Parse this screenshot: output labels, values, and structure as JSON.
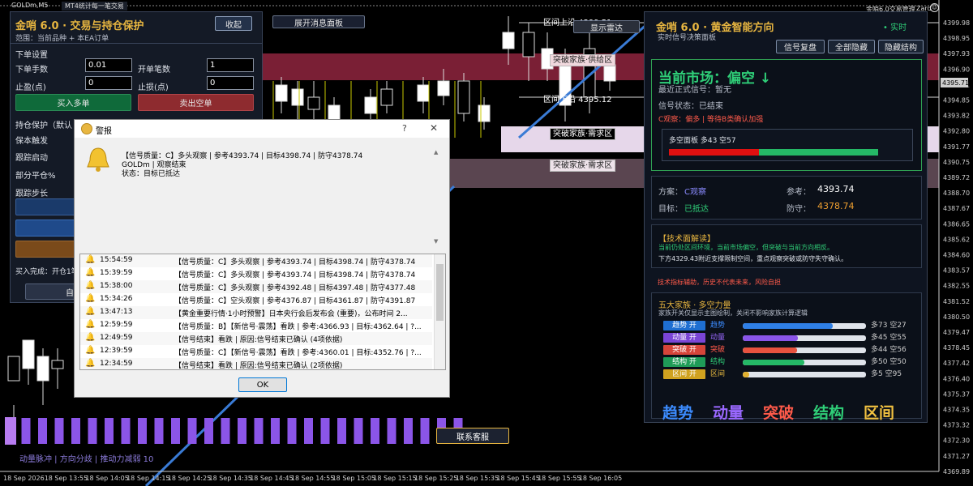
{
  "terminal": {
    "symbol_tab": "GOLDm,M5",
    "ea_tab": "MT4统计每一笔交易",
    "top_right_caption": "金哨6.0交易管理",
    "top_right_user": "Zard"
  },
  "colors": {
    "accent_gold": "#e8b640",
    "buy_green": "#0f6a3a",
    "sell_red": "#8e2b2f",
    "chart_line": "#3a7bd5",
    "zone_supply": "#7a1f35",
    "zone_demand": "#e6d7ea"
  },
  "chart": {
    "btn_expand_msg": "展开消息面板",
    "btn_show_radar": "显示雷达",
    "range_top_label": "区间上沿 4399.51",
    "range_bottom_label": "区间下沿 4395.12",
    "zone_supply_label": "突破家族·供给区",
    "zone_demand1_label": "突破家族·需求区",
    "zone_demand2_label": "突破家族·需求区",
    "indicator_label": "动量脉冲 | 方向分歧 | 推动力减弱 10",
    "service_button": "联系客服",
    "price_axis": [
      "4399.98",
      "4398.95",
      "4397.93",
      "4396.90",
      "4395.71",
      "4394.85",
      "4393.82",
      "4392.80",
      "4391.77",
      "4390.75",
      "4389.72",
      "4388.70",
      "4387.67",
      "4386.65",
      "4385.62",
      "4384.60",
      "4383.57",
      "4382.55",
      "4381.52",
      "4380.50",
      "4379.47",
      "4378.45",
      "4377.42",
      "4376.40",
      "4375.37",
      "4374.35",
      "4373.32",
      "4372.30",
      "4371.27",
      "4369.89"
    ],
    "price_current": "4395.71",
    "time_axis": [
      "18 Sep 2026",
      "18 Sep 13:55",
      "18 Sep 14:05",
      "18 Sep 14:15",
      "18 Sep 14:25",
      "18 Sep 14:35",
      "18 Sep 14:45",
      "18 Sep 14:55",
      "18 Sep 15:05",
      "18 Sep 15:15",
      "18 Sep 15:25",
      "18 Sep 15:35",
      "18 Sep 15:45",
      "18 Sep 15:55",
      "18 Sep 16:05"
    ]
  },
  "left_panel": {
    "title": "金哨 6.0 · 交易与持仓保护",
    "collapse_button": "收起",
    "scope": "范围：当前品种 + 本EA订单",
    "order_settings": "下单设置",
    "lot_label": "下单手数",
    "lot_value": "0.01",
    "count_label": "开单笔数",
    "count_value": "1",
    "tp_label": "止盈(点)",
    "tp_value": "0",
    "sl_label": "止损(点)",
    "sl_value": "0",
    "buy_button": "买入多单",
    "sell_button": "卖出空单",
    "protect_title": "持仓保护（默认",
    "breakeven_label": "保本触发",
    "trail_start_label": "跟踪启动",
    "partial_label": "部分平仓%",
    "trail_step_label": "跟踪步长",
    "immediate_button": "立即",
    "half_button": "平",
    "status_line": "买入完成：开仓1笔",
    "auto_breakeven_button": "自动保本：关"
  },
  "right_panel": {
    "title": "金哨 6.0 · 黄金智能方向",
    "subtitle": "实时信号决策面板",
    "realtime": "• 实时",
    "btn_review": "信号复盘",
    "btn_hide_all": "全部隐藏",
    "btn_hide_struct": "隐藏结构",
    "market_label": "当前市场：偏空 ↓",
    "last_signal": "最近正式信号：暂无",
    "signal_state": "信号状态：已结束",
    "c_watch": "C观察：偏多 | 等待B类确认加强",
    "balance_label": "多空面板  多43 空57",
    "bull_pct": 43,
    "bear_pct": 57,
    "plan_label": "方案：",
    "plan_value": "C观察",
    "ref_label": "参考：",
    "ref_value": "4393.74",
    "target_label": "目标：",
    "target_value": "已抵达",
    "stop_label": "防守：",
    "stop_value": "4378.74",
    "tech_title": "【技术面解读】",
    "tech_line1": "当前仍处区间环境，当前市场偏空，但突破与当前方向相反。",
    "tech_line2": "下方4329.43附近支撑限制空间，重点观察突破或防守失守确认。",
    "disclaimer": "技术指标辅助，历史不代表未来，风险自担",
    "families_title": "五大家族 · 多空力量",
    "families_sub": "家族开关仅显示主图绘制，关闭不影响家族计算逻辑",
    "families": [
      {
        "tag": "趋势 开",
        "name": "趋势",
        "bull": 73,
        "bear": 27,
        "text": "多73 空27",
        "tag_color": "#1f6fd1",
        "name_color": "#3c8cff",
        "fill": "#2f7fe6"
      },
      {
        "tag": "动量 开",
        "name": "动量",
        "bull": 45,
        "bear": 55,
        "text": "多45 空55",
        "tag_color": "#7a45d6",
        "name_color": "#9a68ff",
        "fill": "#8a55e8"
      },
      {
        "tag": "突破 开",
        "name": "突破",
        "bull": 44,
        "bear": 56,
        "text": "多44 空56",
        "tag_color": "#d6453a",
        "name_color": "#ff5a4a",
        "fill": "#e8523f"
      },
      {
        "tag": "结构 开",
        "name": "结构",
        "bull": 50,
        "bear": 50,
        "text": "多50 空50",
        "tag_color": "#1f9c58",
        "name_color": "#2fcf78",
        "fill": "#25b866"
      },
      {
        "tag": "区间 开",
        "name": "区间",
        "bull": 5,
        "bear": 95,
        "text": "多5 空95",
        "tag_color": "#d0a21f",
        "name_color": "#f0c040",
        "fill": "#e0b030"
      }
    ],
    "big_words": [
      "趋势",
      "动量",
      "突破",
      "结构",
      "区间"
    ]
  },
  "alert": {
    "title": "警报",
    "help": "?",
    "close": "✕",
    "msg_line1": "【信号质量：C】多头观察 | 参考4393.74 | 目标4398.74 | 防守4378.74",
    "msg_line2": "GOLDm | 观察结束",
    "msg_line3": "状态：目标已抵达",
    "ok": "OK",
    "rows": [
      {
        "time": "15:54:59",
        "msg": "【信号质量：C】多头观察 | 参考4393.74 | 目标4398.74 | 防守4378.74"
      },
      {
        "time": "15:39:59",
        "msg": "【信号质量：C】多头观察 | 参考4393.74 | 目标4398.74 | 防守4378.74"
      },
      {
        "time": "15:38:00",
        "msg": "【信号质量：C】多头观察 | 参考4392.48 | 目标4397.48 | 防守4377.48"
      },
      {
        "time": "15:34:26",
        "msg": "【信号质量：C】空头观察 | 参考4376.87 | 目标4361.87 | 防守4391.87"
      },
      {
        "time": "13:47:13",
        "msg": "【黄金重要行情·1小时预警】日本央行会后发布会 (重要)，公布时间 2..."
      },
      {
        "time": "12:59:59",
        "msg": "【信号质量：B】【新信号·震荡】看跌 | 参考:4366.93 | 目标:4362.64 | ?..."
      },
      {
        "time": "12:49:59",
        "msg": "【信号结束】看跌 | 原因:信号结束已确认 (4项依据)"
      },
      {
        "time": "12:39:59",
        "msg": "【信号质量：C】【新信号·震荡】看跌 | 参考:4360.01 | 目标:4352.76 | ?..."
      },
      {
        "time": "12:34:59",
        "msg": "【信号结束】看跌 | 原因:信号结束已确认 (2项依据)"
      }
    ]
  }
}
